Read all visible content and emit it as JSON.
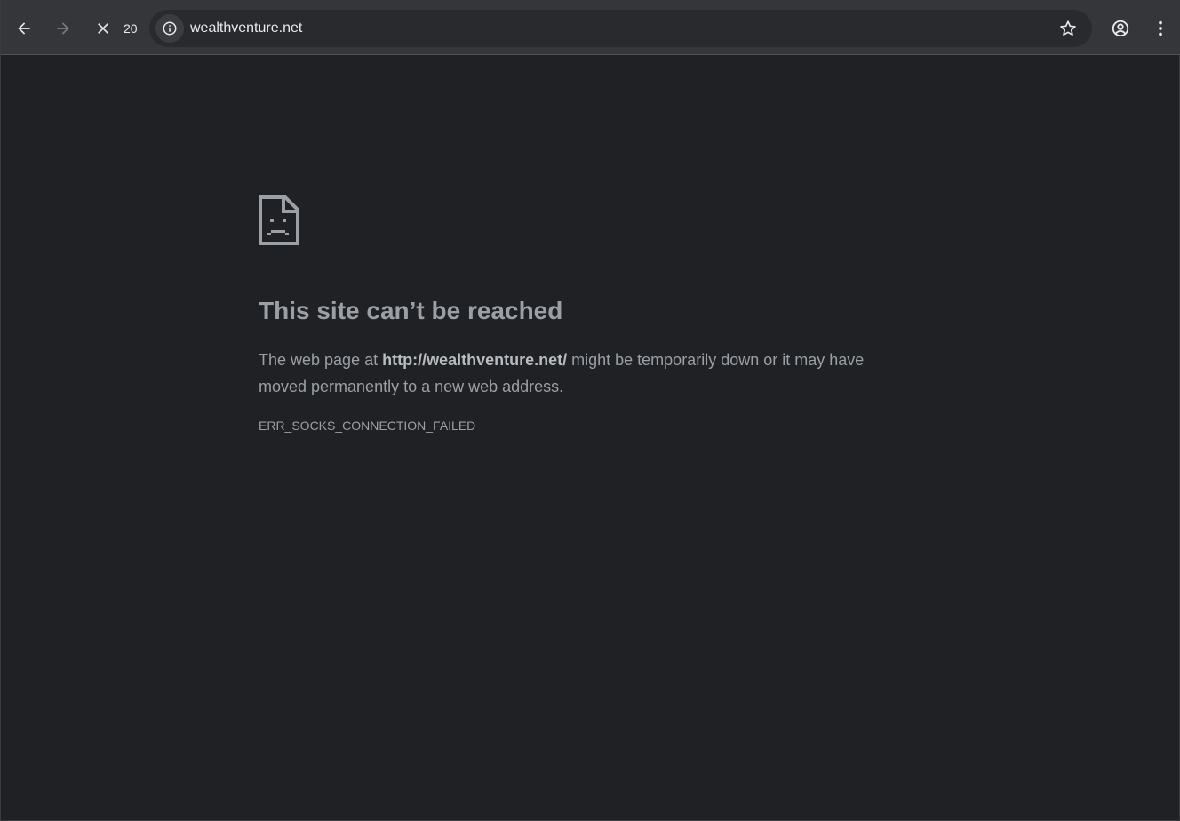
{
  "browser": {
    "load_count": "20",
    "url": "wealthventure.net",
    "icons": {
      "back": "arrow-left-icon",
      "forward": "arrow-right-icon",
      "stop": "close-icon",
      "site_info": "info-icon",
      "bookmark": "star-icon",
      "profile": "account-circle-icon",
      "menu": "more-vert-icon"
    }
  },
  "error": {
    "icon": "sad-page-icon",
    "title": "This site can’t be reached",
    "desc_prefix": "The web page at ",
    "desc_url": "http://wealthventure.net/",
    "desc_suffix": " might be temporarily down or it may have moved permanently to a new web address.",
    "code": "ERR_SOCKS_CONNECTION_FAILED"
  },
  "colors": {
    "background": "#202124",
    "toolbar": "#35363a",
    "text_secondary": "#9aa0a6",
    "text_primary": "#e8eaed"
  }
}
